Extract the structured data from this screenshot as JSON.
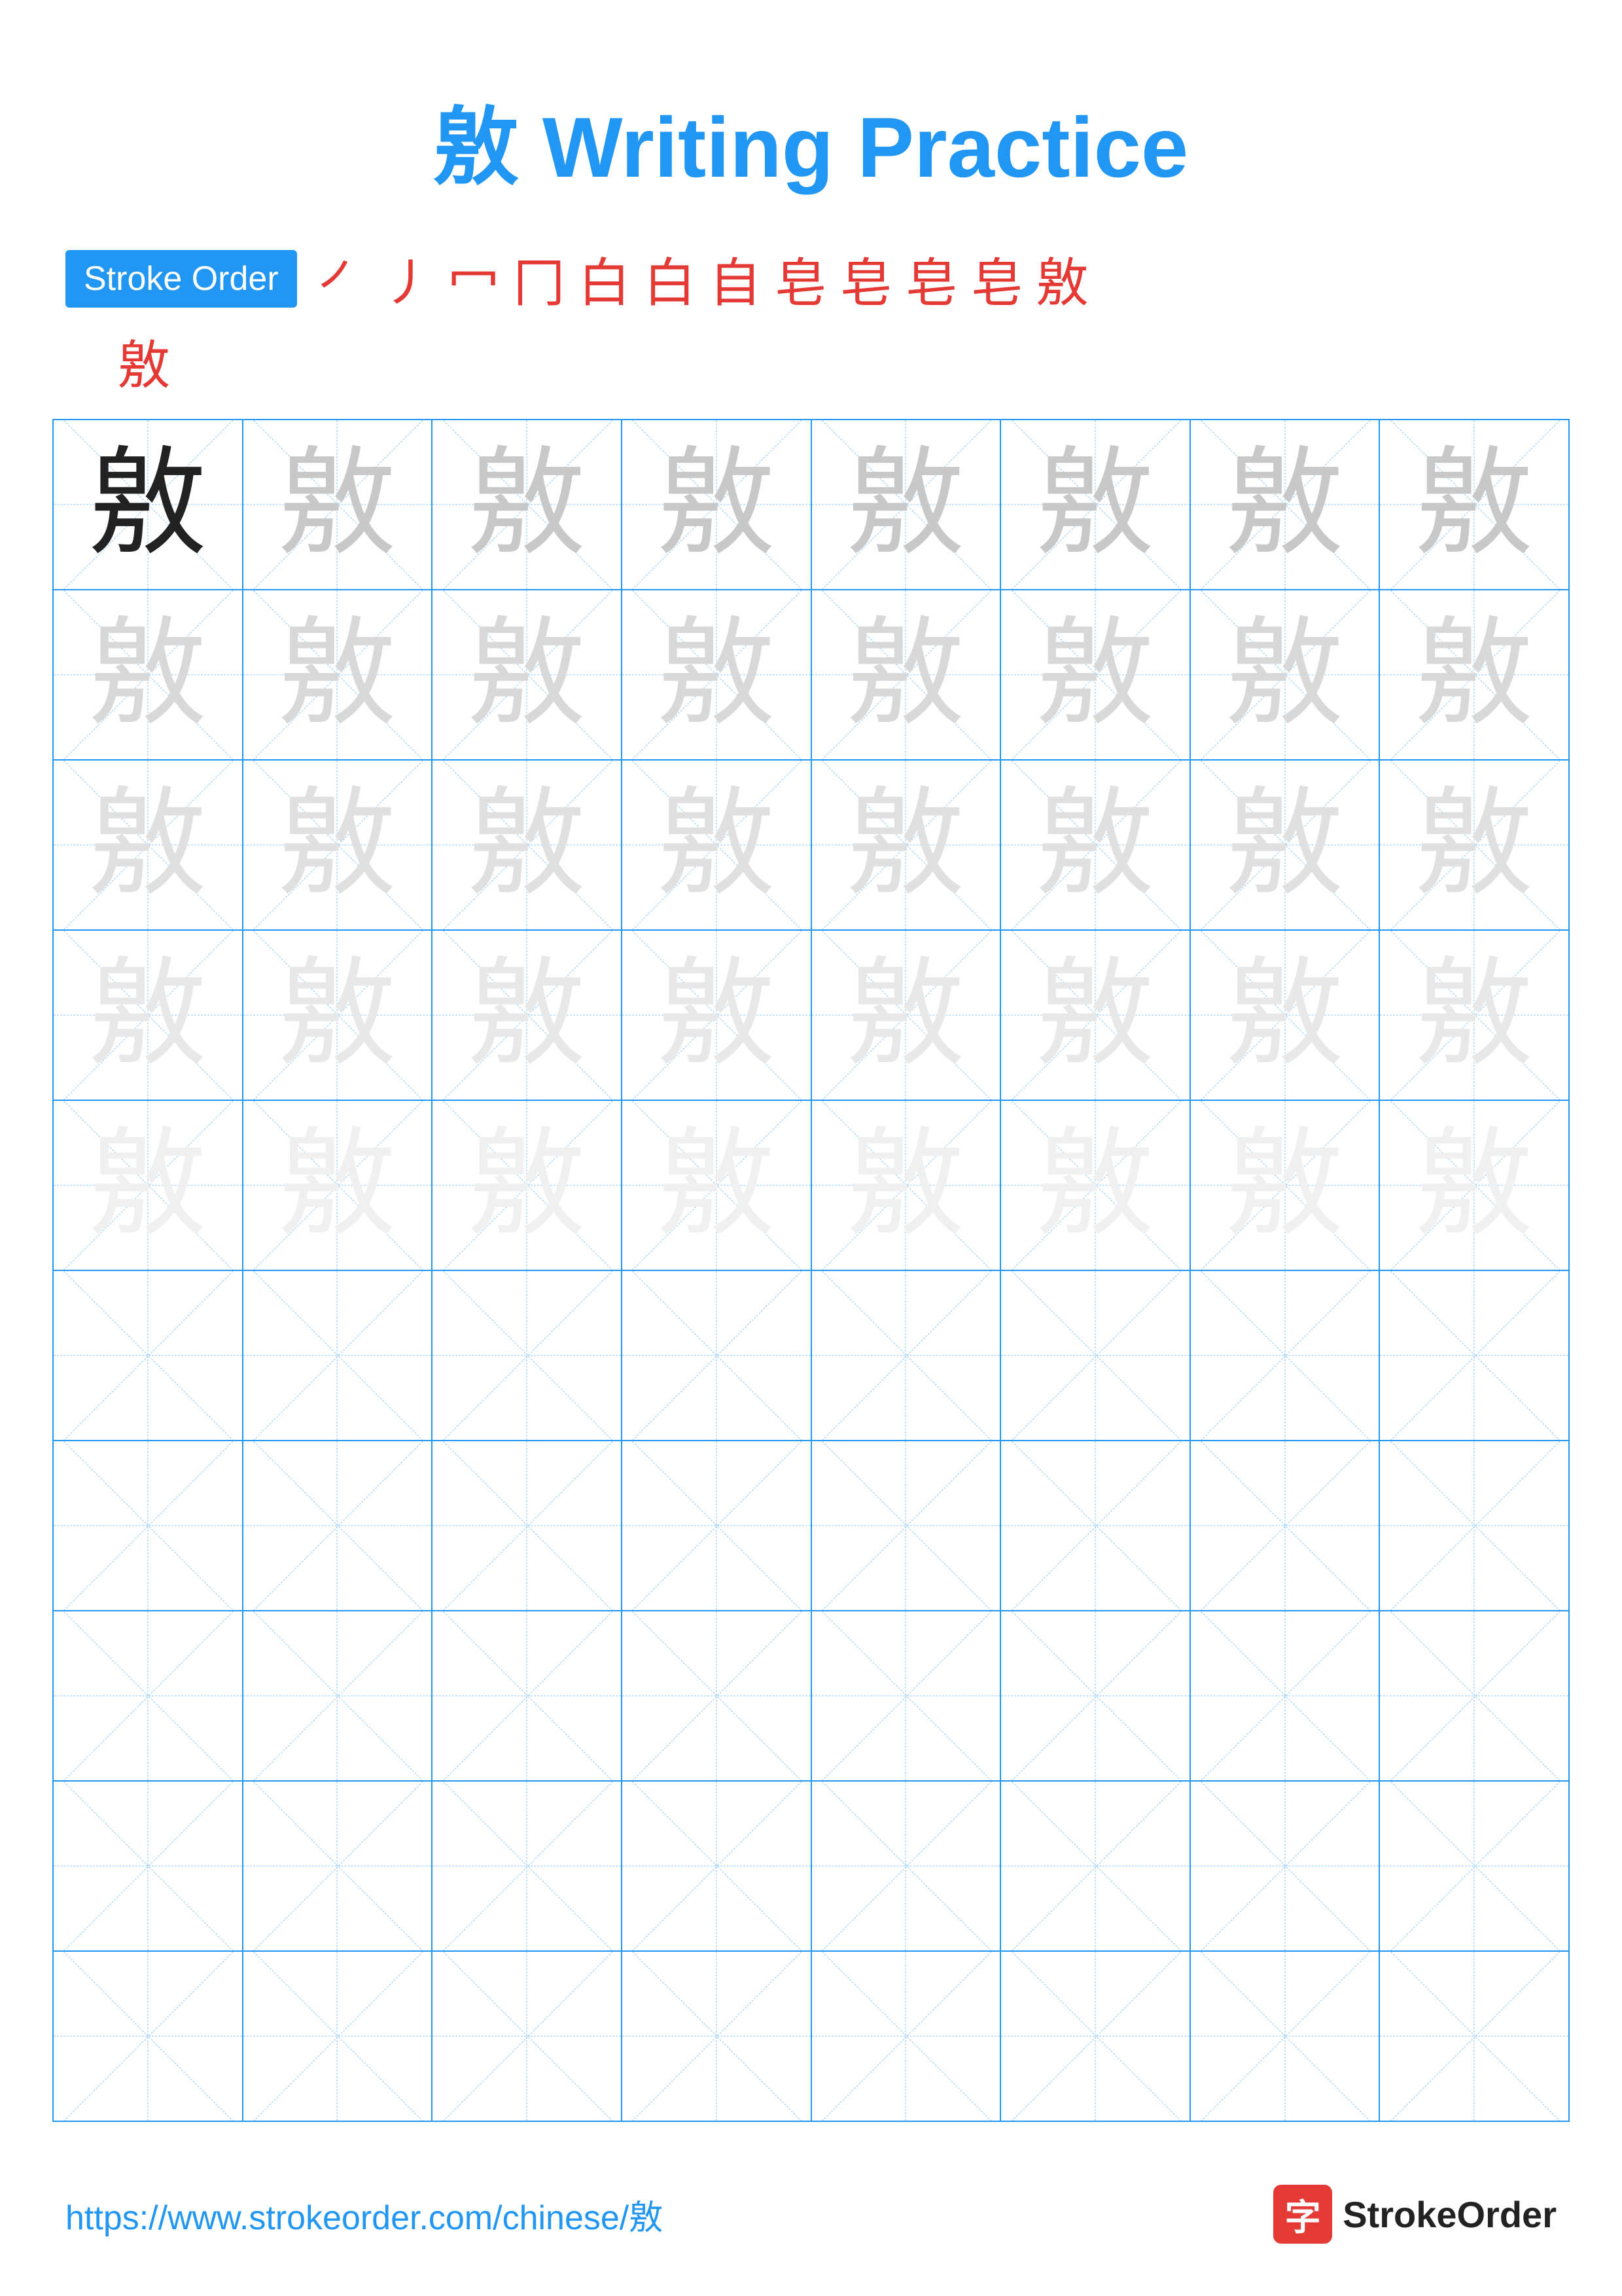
{
  "page": {
    "title": "敫 Writing Practice",
    "character": "敫",
    "stroke_order_label": "Stroke Order",
    "strokes": [
      "㇒",
      "㇓",
      "冖",
      "冂",
      "白",
      "白",
      "自",
      "皂",
      "皂",
      "皂",
      "皂",
      "敫"
    ],
    "footer_url": "https://www.strokeorder.com/chinese/敫",
    "footer_brand_char": "字",
    "footer_brand_name": "StrokeOrder"
  },
  "grid": {
    "rows": 10,
    "cols": 8,
    "filled_rows": 5,
    "character": "敫"
  }
}
